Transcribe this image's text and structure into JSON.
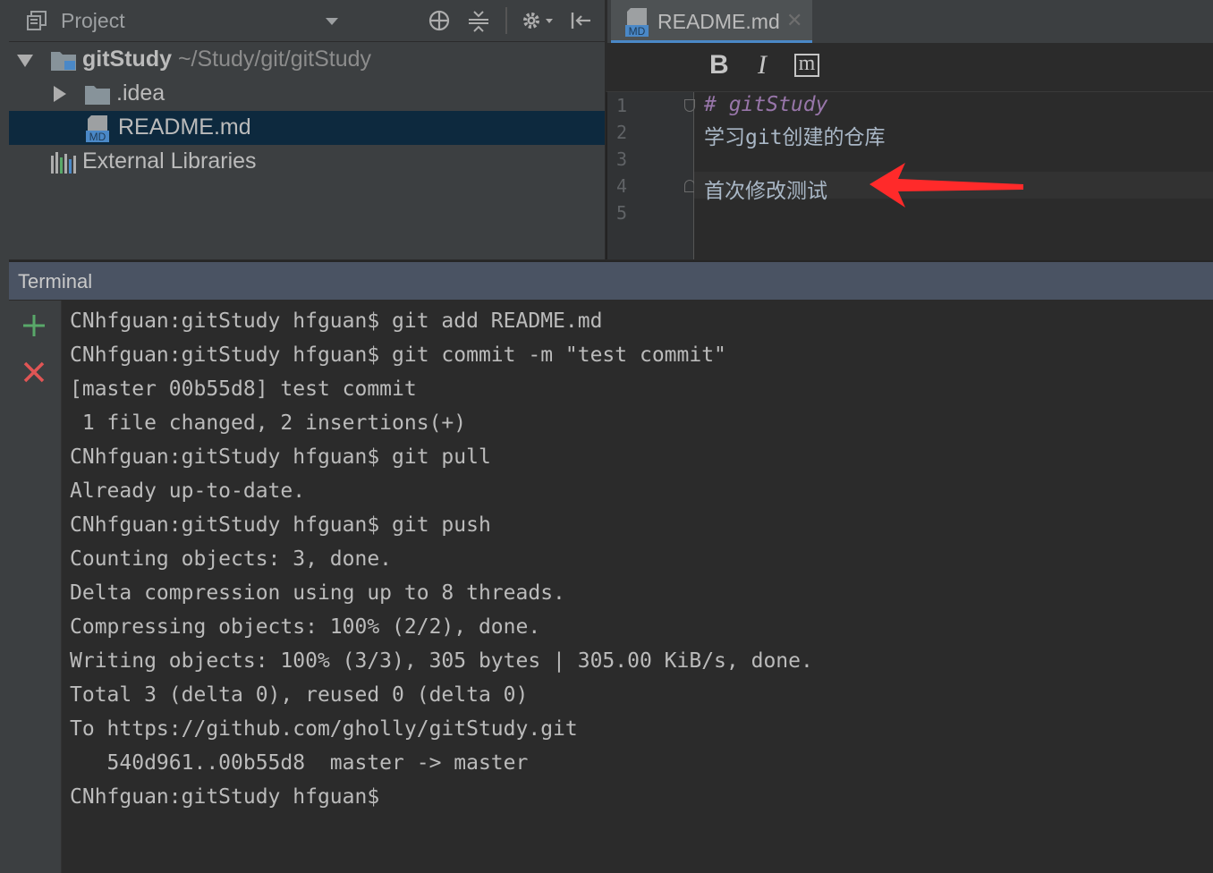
{
  "project_panel": {
    "title": "Project",
    "tree": [
      {
        "name": "gitStudy",
        "path": "~/Study/git/gitStudy",
        "type": "root-folder",
        "expanded": true
      },
      {
        "name": ".idea",
        "type": "folder",
        "expanded": false
      },
      {
        "name": "README.md",
        "type": "md-file",
        "selected": true
      },
      {
        "name": "External Libraries",
        "type": "libraries"
      }
    ],
    "toolbar_icons": [
      "locate-icon",
      "collapse-all-icon",
      "settings-icon",
      "hide-panel-icon"
    ]
  },
  "editor": {
    "tab_label": "README.md",
    "tab_icon_text": "MD",
    "format_buttons": {
      "bold": "B",
      "italic": "I",
      "code": "m"
    },
    "line_numbers": [
      "1",
      "2",
      "3",
      "4",
      "5"
    ],
    "lines": [
      "# gitStudy",
      "学习git创建的仓库",
      "",
      "首次修改测试",
      ""
    ],
    "annotation": {
      "type": "arrow",
      "color": "#ff2a2a",
      "points_to_line": 4
    }
  },
  "terminal": {
    "title": "Terminal",
    "lines": [
      "CNhfguan:gitStudy hfguan$ git add README.md",
      "CNhfguan:gitStudy hfguan$ git commit -m \"test commit\"",
      "[master 00b55d8] test commit",
      " 1 file changed, 2 insertions(+)",
      "CNhfguan:gitStudy hfguan$ git pull",
      "Already up-to-date.",
      "CNhfguan:gitStudy hfguan$ git push",
      "Counting objects: 3, done.",
      "Delta compression using up to 8 threads.",
      "Compressing objects: 100% (2/2), done.",
      "Writing objects: 100% (3/3), 305 bytes | 305.00 KiB/s, done.",
      "Total 3 (delta 0), reused 0 (delta 0)",
      "To https://github.com/gholly/gitStudy.git",
      "   540d961..00b55d8  master -> master",
      "CNhfguan:gitStudy hfguan$"
    ]
  },
  "colors": {
    "accent": "#4a88c7",
    "selection": "#0d293e",
    "new_session": "#59a869",
    "close_session": "#e05555",
    "annotation_arrow": "#ff2a2a"
  }
}
